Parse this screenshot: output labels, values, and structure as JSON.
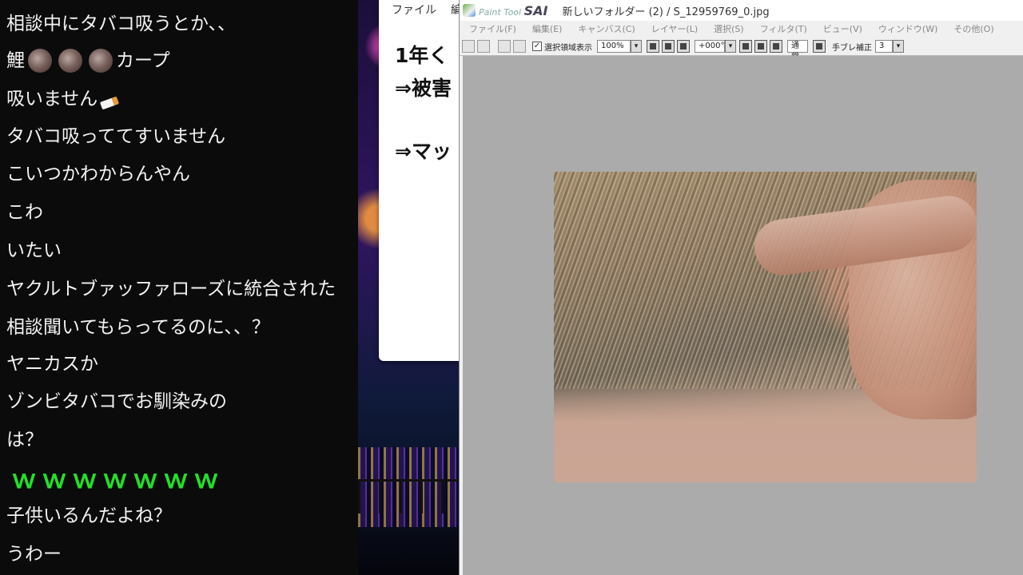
{
  "chat": {
    "lines": [
      "相談中にタバコ吸うとか、、",
      "鯉",
      "カープ",
      "吸いません",
      "タバコ吸っててすいません",
      "こいつかわからんやん",
      "こわ",
      "いたい",
      "ヤクルトブァッファローズに統合された",
      "相談聞いてもらってるのに、、？",
      "ヤニカスか",
      "ゾンビタバコでお馴染みの",
      "は？",
      "ｗｗｗｗｗｗｗ",
      "子供いるんだよね？",
      "うわー"
    ]
  },
  "doc_window": {
    "menu": [
      "ファイル",
      "編"
    ],
    "lines": [
      "1年く",
      "⇒被害",
      "⇒マッ"
    ]
  },
  "sai": {
    "brand_small": "Paint Tool",
    "brand": "SAI",
    "title": "新しいフォルダー (2) / S_12959769_0.jpg",
    "menu": [
      "ファイル(F)",
      "編集(E)",
      "キャンバス(C)",
      "レイヤー(L)",
      "選択(S)",
      "フィルタ(T)",
      "ビュー(V)",
      "ウィンドウ(W)",
      "その他(O)"
    ],
    "toolbar": {
      "selection_label": "選択領域表示",
      "selection_checked": "✓",
      "zoom": "100%",
      "rotation": "+000°",
      "blend_mode": "通常",
      "stabilizer_label": "手ブレ補正",
      "stabilizer": "3"
    }
  }
}
